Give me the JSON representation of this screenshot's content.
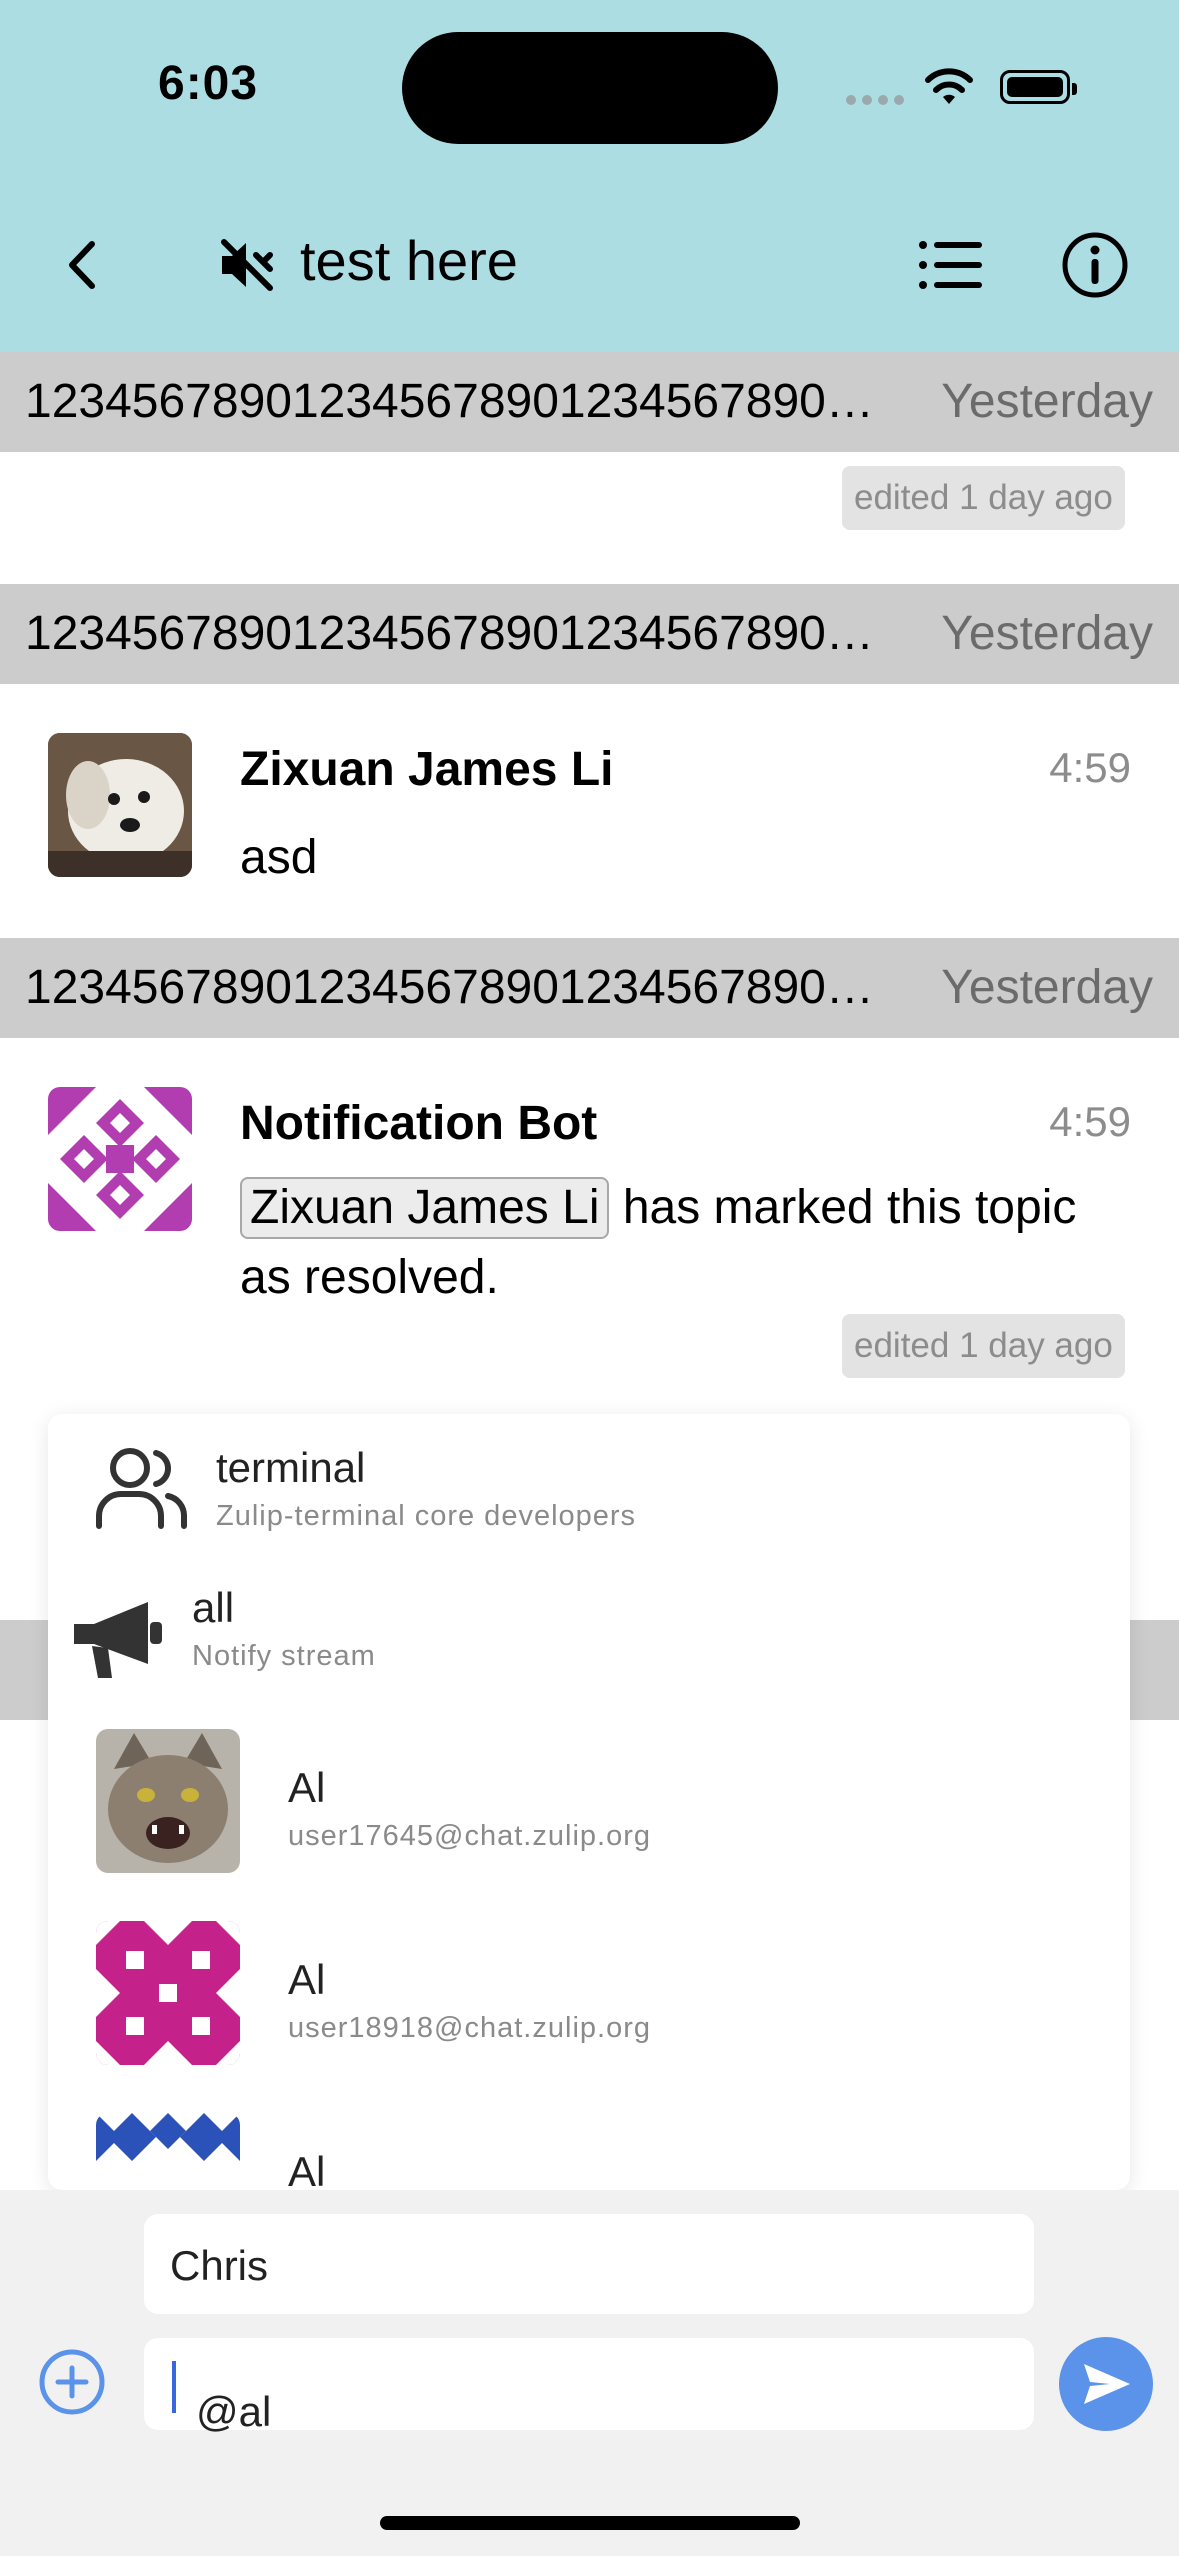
{
  "status_bar": {
    "time": "6:03"
  },
  "nav": {
    "title": "test here"
  },
  "messages": {
    "recipient_headers": [
      {
        "topic": "12345678901234567890123456789012345678901234567890",
        "date": "Yesterday"
      },
      {
        "topic": "12345678901234567890123456789012345678901234567890",
        "date": "Yesterday"
      },
      {
        "topic": "12345678901234567890123456789012345678901234567890",
        "date": "Yesterday"
      }
    ],
    "edited_label": "edited 1 day ago",
    "items": [
      {
        "sender": "Zixuan James Li",
        "time": "4:59",
        "text": "asd"
      },
      {
        "sender": "Notification Bot",
        "time": "4:59",
        "mention": "Zixuan James Li",
        "text": " has marked this topic as resolved."
      }
    ]
  },
  "autocomplete": {
    "items": [
      {
        "title": "terminal",
        "subtitle": "Zulip-terminal core developers",
        "icon": "user-group-icon"
      },
      {
        "title": "all",
        "subtitle": "Notify stream",
        "icon": "megaphone-icon"
      },
      {
        "title": "Al",
        "subtitle": "user17645@chat.zulip.org",
        "icon": "cat-avatar"
      },
      {
        "title": "Al",
        "subtitle": "user18918@chat.zulip.org",
        "icon": "identicon-avatar"
      },
      {
        "title": "Al",
        "subtitle": "",
        "icon": "identicon-avatar"
      }
    ]
  },
  "compose": {
    "topic_value": "Chris",
    "content_value": "@al"
  },
  "colors": {
    "header_bg": "#acdde3",
    "recipient_bg": "#cccccc",
    "send_button": "#5b92ea"
  }
}
